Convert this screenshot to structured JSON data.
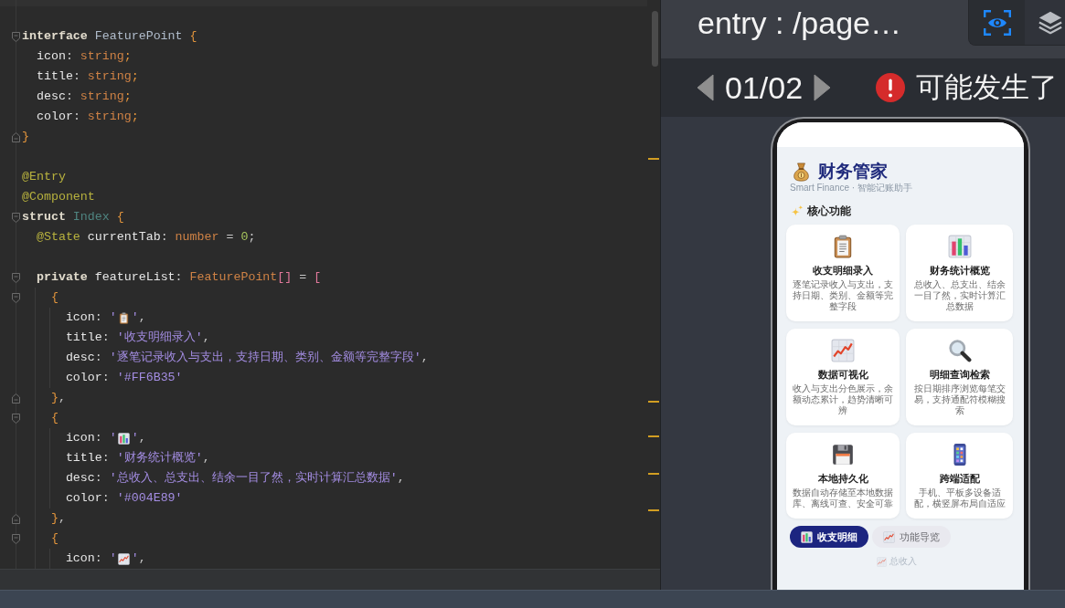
{
  "editor": {
    "blocks": [
      [
        {
          "kind": "opener",
          "tokens": [
            {
              "kind": "keyword",
              "text": "interface "
            },
            {
              "kind": "type",
              "text": "FeaturePoint "
            },
            {
              "kind": "brace",
              "text": "{"
            }
          ]
        },
        {
          "kind": "plain",
          "tokens": [
            {
              "kind": "field",
              "text": "  icon"
            },
            {
              "kind": "punct",
              "text": ": "
            },
            {
              "kind": "typeref",
              "text": "string"
            },
            {
              "kind": "brace",
              "text": ";"
            }
          ]
        },
        {
          "kind": "plain",
          "tokens": [
            {
              "kind": "field",
              "text": "  title"
            },
            {
              "kind": "punct",
              "text": ": "
            },
            {
              "kind": "typeref",
              "text": "string"
            },
            {
              "kind": "brace",
              "text": ";"
            }
          ]
        },
        {
          "kind": "plain",
          "tokens": [
            {
              "kind": "field",
              "text": "  desc"
            },
            {
              "kind": "punct",
              "text": ": "
            },
            {
              "kind": "typeref",
              "text": "string"
            },
            {
              "kind": "brace",
              "text": ";"
            }
          ]
        },
        {
          "kind": "plain",
          "tokens": [
            {
              "kind": "field",
              "text": "  color"
            },
            {
              "kind": "punct",
              "text": ": "
            },
            {
              "kind": "typeref",
              "text": "string"
            },
            {
              "kind": "brace",
              "text": ";"
            }
          ]
        },
        {
          "kind": "closer",
          "tokens": [
            {
              "kind": "brace",
              "text": "}"
            }
          ]
        }
      ],
      [
        {
          "kind": "plain",
          "tokens": [
            {
              "kind": "decorator",
              "text": "@Entry"
            }
          ]
        },
        {
          "kind": "plain",
          "tokens": [
            {
              "kind": "decorator",
              "text": "@Component"
            }
          ]
        },
        {
          "kind": "opener",
          "tokens": [
            {
              "kind": "keyword",
              "text": "struct "
            },
            {
              "kind": "classname",
              "text": "Index "
            },
            {
              "kind": "brace",
              "text": "{"
            }
          ]
        },
        {
          "kind": "plain",
          "tokens": [
            {
              "kind": "decorator",
              "text": "  @State "
            },
            {
              "kind": "field",
              "text": "currentTab"
            },
            {
              "kind": "punct",
              "text": ": "
            },
            {
              "kind": "typeref",
              "text": "number"
            },
            {
              "kind": "punct",
              "text": " = "
            },
            {
              "kind": "number",
              "text": "0"
            },
            {
              "kind": "punct",
              "text": ";"
            }
          ]
        }
      ],
      [
        {
          "kind": "opener",
          "tokens": [
            {
              "kind": "keyword",
              "text": "  private "
            },
            {
              "kind": "field",
              "text": "featureList"
            },
            {
              "kind": "punct",
              "text": ": "
            },
            {
              "kind": "typeref",
              "text": "FeaturePoint"
            },
            {
              "kind": "bracket",
              "text": "[]"
            },
            {
              "kind": "punct",
              "text": " = "
            },
            {
              "kind": "bracket",
              "text": "["
            }
          ]
        },
        {
          "kind": "opener",
          "tokens": [
            {
              "kind": "brace",
              "text": "    {"
            }
          ]
        },
        {
          "kind": "plain",
          "tokens": [
            {
              "kind": "field",
              "text": "      icon"
            },
            {
              "kind": "punct",
              "text": ": "
            },
            {
              "kind": "string",
              "text": "'"
            },
            {
              "kind": "emoji"
            },
            {
              "kind": "string",
              "text": "'"
            },
            {
              "kind": "punct",
              "text": ","
            }
          ]
        },
        {
          "kind": "plain",
          "tokens": [
            {
              "kind": "field",
              "text": "      title"
            },
            {
              "kind": "punct",
              "text": ": "
            },
            {
              "kind": "string",
              "text": "'收支明细录入'"
            },
            {
              "kind": "punct",
              "text": ","
            }
          ]
        },
        {
          "kind": "plain",
          "tokens": [
            {
              "kind": "field",
              "text": "      desc"
            },
            {
              "kind": "punct",
              "text": ": "
            },
            {
              "kind": "string",
              "text": "'逐笔记录收入与支出，支持日期、类别、金额等完整字段'"
            },
            {
              "kind": "punct",
              "text": ","
            }
          ]
        },
        {
          "kind": "plain",
          "tokens": [
            {
              "kind": "field",
              "text": "      color"
            },
            {
              "kind": "punct",
              "text": ": "
            },
            {
              "kind": "string",
              "text": "'#FF6B35'"
            }
          ]
        },
        {
          "kind": "closer",
          "tokens": [
            {
              "kind": "brace",
              "text": "    }"
            },
            {
              "kind": "punct",
              "text": ","
            }
          ]
        },
        {
          "kind": "opener",
          "tokens": [
            {
              "kind": "brace",
              "text": "    {"
            }
          ]
        },
        {
          "kind": "plain",
          "tokens": [
            {
              "kind": "field",
              "text": "      icon"
            },
            {
              "kind": "punct",
              "text": ": "
            },
            {
              "kind": "string",
              "text": "'"
            },
            {
              "kind": "emoji"
            },
            {
              "kind": "string",
              "text": "'"
            },
            {
              "kind": "punct",
              "text": ","
            }
          ]
        },
        {
          "kind": "plain",
          "tokens": [
            {
              "kind": "field",
              "text": "      title"
            },
            {
              "kind": "punct",
              "text": ": "
            },
            {
              "kind": "string",
              "text": "'财务统计概览'"
            },
            {
              "kind": "punct",
              "text": ","
            }
          ]
        },
        {
          "kind": "plain",
          "tokens": [
            {
              "kind": "field",
              "text": "      desc"
            },
            {
              "kind": "punct",
              "text": ": "
            },
            {
              "kind": "string",
              "text": "'总收入、总支出、结余一目了然，实时计算汇总数据'"
            },
            {
              "kind": "punct",
              "text": ","
            }
          ]
        },
        {
          "kind": "plain",
          "tokens": [
            {
              "kind": "field",
              "text": "      color"
            },
            {
              "kind": "punct",
              "text": ": "
            },
            {
              "kind": "string",
              "text": "'#004E89'"
            }
          ]
        },
        {
          "kind": "closer",
          "tokens": [
            {
              "kind": "brace",
              "text": "    }"
            },
            {
              "kind": "punct",
              "text": ","
            }
          ]
        },
        {
          "kind": "opener",
          "tokens": [
            {
              "kind": "brace",
              "text": "    {"
            }
          ]
        },
        {
          "kind": "plain",
          "tokens": [
            {
              "kind": "field",
              "text": "      icon"
            },
            {
              "kind": "punct",
              "text": ": "
            },
            {
              "kind": "string",
              "text": "'"
            },
            {
              "kind": "emoji"
            },
            {
              "kind": "string",
              "text": "'"
            },
            {
              "kind": "punct",
              "text": ","
            }
          ]
        }
      ]
    ]
  },
  "preview": {
    "path_title": "entry : /page…",
    "view_buttons": [
      {
        "selected": true
      },
      {
        "selected": false
      }
    ],
    "pager": "01/02",
    "alert": "可能发生了",
    "app": {
      "title": "财务管家",
      "subtitle": "Smart Finance · 智能记账助手",
      "section_title": "核心功能",
      "features": [
        {
          "title": "收支明细录入",
          "desc": "逐笔记录收入与支出，支持日期、类别、金额等完整字段"
        },
        {
          "title": "财务统计概览",
          "desc": "总收入、总支出、结余一目了然，实时计算汇总数据"
        },
        {
          "title": "数据可视化",
          "desc": "收入与支出分色展示，余额动态累计，趋势清晰可辨"
        },
        {
          "title": "明细查询检索",
          "desc": "按日期排序浏览每笔交易，支持通配符模糊搜索"
        },
        {
          "title": "本地持久化",
          "desc": "数据自动存储至本地数据库、离线可查、安全可靠"
        },
        {
          "title": "跨端适配",
          "desc": "手机、平板多设备适配，横竖屏布局自适应"
        }
      ],
      "tabs": [
        {
          "label": "收支明细",
          "selected": true,
          "disabled": false
        },
        {
          "label": "功能导览",
          "selected": false,
          "disabled": false
        },
        {
          "label": "总收入",
          "selected": false,
          "disabled": true
        }
      ]
    }
  }
}
